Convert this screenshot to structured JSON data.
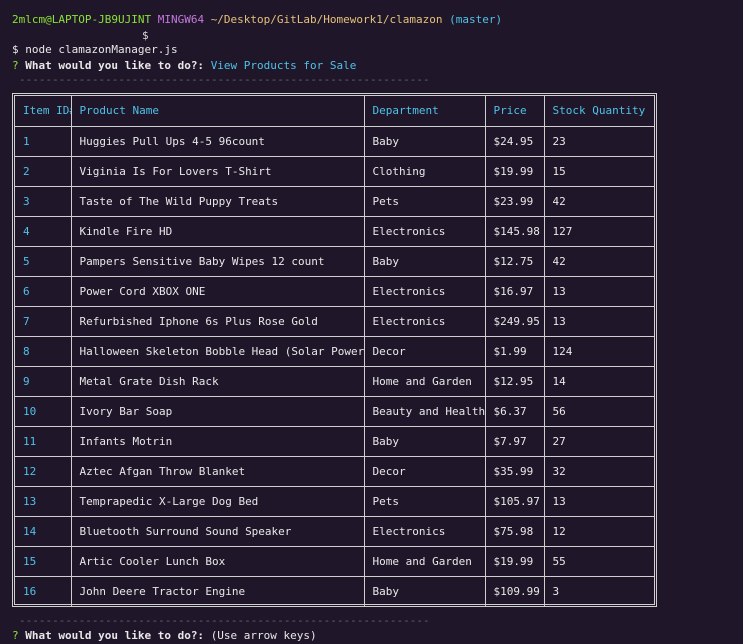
{
  "prompt_line": {
    "user_host": "2mlcm@LAPTOP-JB9UJINT",
    "shell": "MINGW64",
    "path": "~/Desktop/GitLab/Homework1/clamazon",
    "branch": "(master)",
    "dollar": "$"
  },
  "command": "$ node clamazonManager.js",
  "question1": {
    "mark": "?",
    "text": "What would you like to do?:",
    "answer": "View Products for Sale"
  },
  "separator": "------------------------------------------------------------------------",
  "table": {
    "headers": [
      "Item ID#",
      "Product Name",
      "Department",
      "Price",
      "Stock Quantity"
    ],
    "rows": [
      [
        "1",
        "Huggies Pull Ups 4-5 96count",
        "Baby",
        "$24.95",
        "23"
      ],
      [
        "2",
        "Viginia Is For Lovers T-Shirt",
        "Clothing",
        "$19.99",
        "15"
      ],
      [
        "3",
        "Taste of The Wild Puppy Treats",
        "Pets",
        "$23.99",
        "42"
      ],
      [
        "4",
        "Kindle Fire HD",
        "Electronics",
        "$145.98",
        "127"
      ],
      [
        "5",
        "Pampers Sensitive Baby Wipes 12 count",
        "Baby",
        "$12.75",
        "42"
      ],
      [
        "6",
        "Power Cord XBOX ONE",
        "Electronics",
        "$16.97",
        "13"
      ],
      [
        "7",
        "Refurbished Iphone 6s Plus Rose Gold",
        "Electronics",
        "$249.95",
        "13"
      ],
      [
        "8",
        "Halloween Skeleton Bobble Head (Solar Powered)",
        "Decor",
        "$1.99",
        "124"
      ],
      [
        "9",
        "Metal Grate Dish Rack",
        "Home and Garden",
        "$12.95",
        "14"
      ],
      [
        "10",
        "Ivory Bar Soap",
        "Beauty and Health",
        "$6.37",
        "56"
      ],
      [
        "11",
        "Infants Motrin",
        "Baby",
        "$7.97",
        "27"
      ],
      [
        "12",
        "Aztec Afgan Throw Blanket",
        "Decor",
        "$35.99",
        "32"
      ],
      [
        "13",
        "Temprapedic X-Large Dog Bed",
        "Pets",
        "$105.97",
        "13"
      ],
      [
        "14",
        "Bluetooth Surround Sound Speaker",
        "Electronics",
        "$75.98",
        "12"
      ],
      [
        "15",
        "Artic Cooler Lunch Box",
        "Home and Garden",
        "$19.99",
        "55"
      ],
      [
        "16",
        "John Deere Tractor Engine",
        "Baby",
        "$109.99",
        "3"
      ]
    ]
  },
  "question2": {
    "mark": "?",
    "text": "What would you like to do?:",
    "hint": "(Use arrow keys)"
  }
}
